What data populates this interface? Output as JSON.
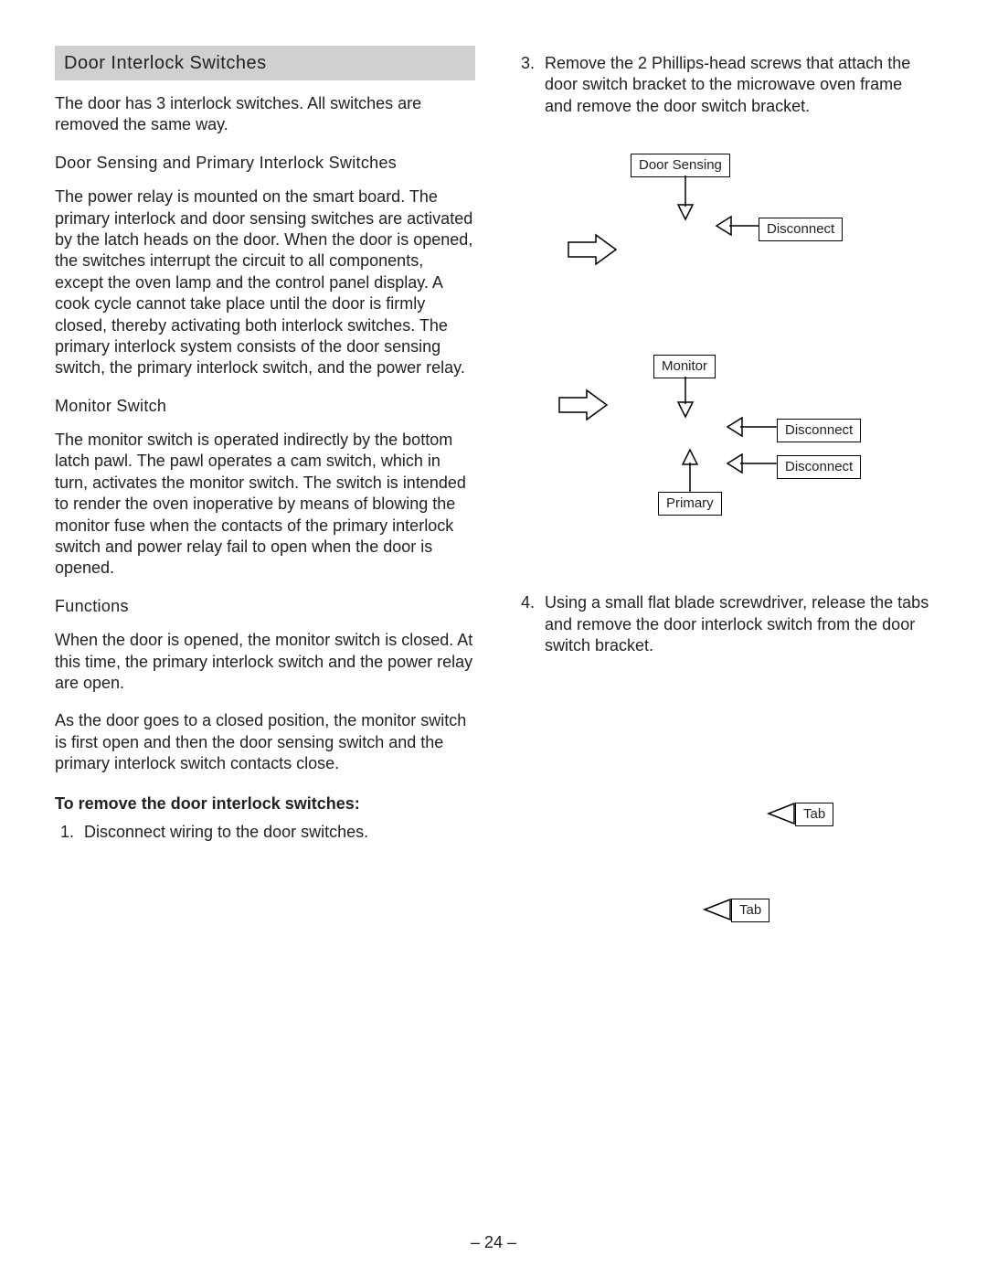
{
  "page_number": "– 24 –",
  "left": {
    "section_title": "Door Interlock Switches",
    "intro": "The door has 3 interlock switches. All switches are removed the same way.",
    "h1": "Door Sensing and Primary Interlock Switches",
    "p1": "The power relay is mounted on the smart board. The primary interlock and door sensing switches are activated by the latch heads on the door. When the door is opened, the switches interrupt the circuit to all components, except the oven lamp and the control panel display. A cook cycle cannot take place until the door is firmly closed, thereby activating both interlock switches. The primary interlock system consists of the door sensing switch, the primary interlock switch, and the power relay.",
    "h2": "Monitor Switch",
    "p2": "The monitor switch is operated indirectly by the bottom latch pawl. The pawl operates a cam switch, which in turn, activates the monitor switch. The switch is intended to render the oven inoperative by means of blowing the monitor fuse when the contacts of the primary interlock switch and power relay fail to open when the door is opened.",
    "h3": "Functions",
    "p3": "When the door is opened, the monitor switch is closed. At this time, the primary interlock switch and the power relay are open.",
    "p4": "As the door goes to a closed position, the monitor switch is first open and then the door sensing switch and the primary interlock switch contacts close.",
    "h4": "To remove the door interlock switches:",
    "step1": "Disconnect wiring to the door switches."
  },
  "right": {
    "step3": "Remove the 2 Phillips-head screws that attach the door switch bracket to the microwave oven frame and remove the door switch bracket.",
    "step4": "Using a small flat blade screwdriver, release the tabs and remove the door interlock switch from the door switch bracket.",
    "labels": {
      "door_sensing": "Door Sensing",
      "monitor": "Monitor",
      "primary": "Primary",
      "disconnect": "Disconnect",
      "tab": "Tab"
    }
  }
}
